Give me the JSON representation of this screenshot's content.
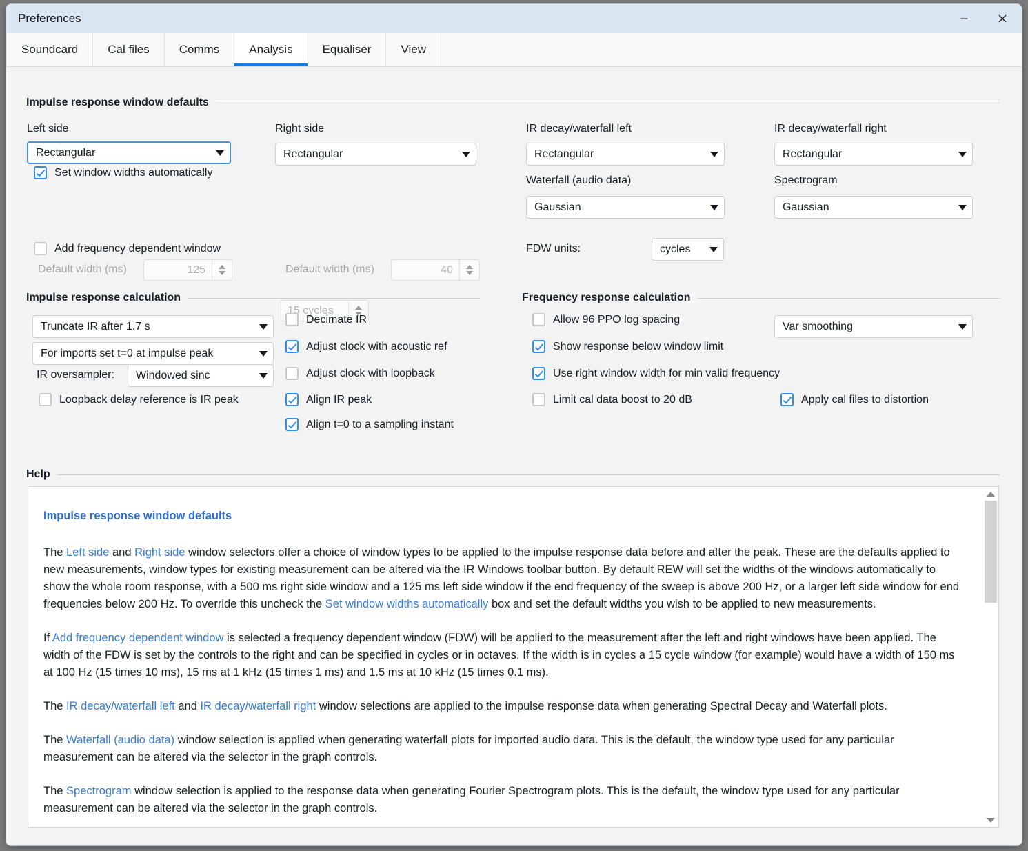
{
  "window": {
    "title": "Preferences",
    "minimize_label": "Minimize",
    "close_label": "Close"
  },
  "tabs": [
    {
      "label": "Soundcard",
      "active": false
    },
    {
      "label": "Cal files",
      "active": false
    },
    {
      "label": "Comms",
      "active": false
    },
    {
      "label": "Analysis",
      "active": true
    },
    {
      "label": "Equaliser",
      "active": false
    },
    {
      "label": "View",
      "active": false
    }
  ],
  "ir_window_defaults": {
    "title": "Impulse response window defaults",
    "left_side_label": "Left side",
    "left_side_value": "Rectangular",
    "right_side_label": "Right side",
    "right_side_value": "Rectangular",
    "set_widths_auto_label": "Set window widths automatically",
    "set_widths_auto_checked": true,
    "left_default_width_label": "Default width (ms)",
    "left_default_width_value": "125",
    "right_default_width_label": "Default width (ms)",
    "right_default_width_value": "40",
    "add_fdw_label": "Add frequency dependent window",
    "add_fdw_checked": false,
    "fdw_cycles_value": "15 cycles",
    "decay_left_label": "IR decay/waterfall left",
    "decay_left_value": "Rectangular",
    "decay_right_label": "IR decay/waterfall right",
    "decay_right_value": "Rectangular",
    "waterfall_label": "Waterfall (audio data)",
    "waterfall_value": "Gaussian",
    "spectrogram_label": "Spectrogram",
    "spectrogram_value": "Gaussian",
    "fdw_units_label": "FDW units:",
    "fdw_units_value": "cycles"
  },
  "ir_calculation": {
    "title": "Impulse response calculation",
    "truncate_value": "Truncate IR after 1.7 s",
    "imports_value": "For imports set t=0 at impulse peak",
    "oversampler_label": "IR oversampler:",
    "oversampler_value": "Windowed sinc",
    "loopback_delay_label": "Loopback delay reference is IR peak",
    "loopback_delay_checked": false,
    "decimate_label": "Decimate IR",
    "decimate_checked": false,
    "adjust_acoustic_label": "Adjust clock with acoustic ref",
    "adjust_acoustic_checked": true,
    "adjust_loopback_label": "Adjust clock with loopback",
    "adjust_loopback_checked": false,
    "align_ir_peak_label": "Align IR peak",
    "align_ir_peak_checked": true,
    "align_t0_label": "Align t=0 to a sampling instant",
    "align_t0_checked": true
  },
  "fr_calculation": {
    "title": "Frequency response calculation",
    "allow_96ppo_label": "Allow 96 PPO log spacing",
    "allow_96ppo_checked": false,
    "show_below_window_label": "Show response below window limit",
    "show_below_window_checked": true,
    "use_right_window_label": "Use right window width for min valid frequency",
    "use_right_window_checked": true,
    "limit_cal_boost_label": "Limit cal data boost to 20 dB",
    "limit_cal_boost_checked": false,
    "apply_cal_distortion_label": "Apply cal files to distortion",
    "apply_cal_distortion_checked": true,
    "smoothing_value": "Var smoothing"
  },
  "help": {
    "title": "Help",
    "heading": "Impulse response window defaults",
    "p1_a": "The ",
    "p1_link1": "Left side",
    "p1_b": " and ",
    "p1_link2": "Right side",
    "p1_c": " window selectors offer a choice of window types to be applied to the impulse response data before and after the peak. These are the defaults applied to new measurements, window types for existing measurement can be altered via the IR Windows toolbar button. By default REW will set the widths of the windows automatically to show the whole room response, with a 500 ms right side window and a 125 ms left side window if the end frequency of the sweep is above 200 Hz, or a larger left side window for end frequencies below 200 Hz. To override this uncheck the ",
    "p1_link3": "Set window widths automatically",
    "p1_d": " box and set the default widths you wish to be applied to new measurements.",
    "p2_a": "If ",
    "p2_link1": "Add frequency dependent window",
    "p2_b": " is selected a frequency dependent window (FDW) will be applied to the measurement after the left and right windows have been applied. The width of the FDW is set by the controls to the right and can be specified in cycles or in octaves. If the width is in cycles a 15 cycle window (for example) would have a width of 150 ms at 100 Hz (15 times 10 ms), 15 ms at 1 kHz (15 times 1 ms) and 1.5 ms at 10 kHz (15 times 0.1 ms).",
    "p3_a": "The ",
    "p3_link1": "IR decay/waterfall left",
    "p3_b": " and ",
    "p3_link2": "IR decay/waterfall right",
    "p3_c": " window selections are applied to the impulse response data when generating Spectral Decay and Waterfall plots.",
    "p4_a": "The ",
    "p4_link1": "Waterfall (audio data)",
    "p4_b": " window selection is applied when generating waterfall plots for imported audio data. This is the default, the window type used for any particular measurement can be altered via the selector in the graph controls.",
    "p5_a": "The ",
    "p5_link1": "Spectrogram",
    "p5_b": " window selection is applied to the response data when generating Fourier Spectrogram plots. This is the default, the window type used for any particular measurement can be altered via the selector in the graph controls.",
    "scroll_up_label": "Scroll up",
    "scroll_down_label": "Scroll down"
  },
  "colors": {
    "accent": "#1878e6",
    "checkbox_on": "#2f8ef0",
    "link": "#3a7bd5",
    "titlebar": "#dbe6f3"
  }
}
